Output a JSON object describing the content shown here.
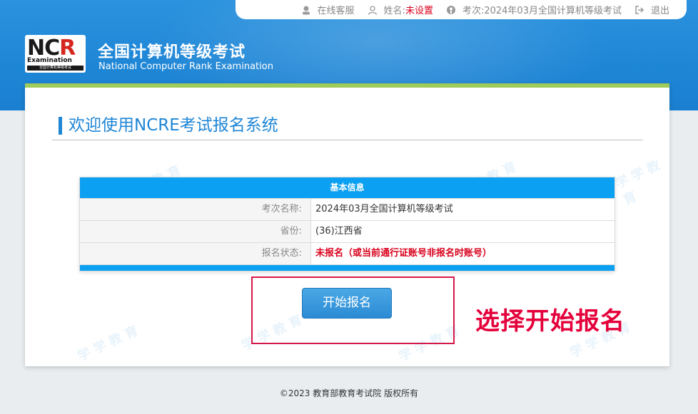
{
  "topbar": {
    "service": "在线客服",
    "name_label": "姓名:",
    "name_value": "未设置",
    "session_label": "考次:",
    "session_value": "2024年03月全国计算机等级考试",
    "logout": "退出"
  },
  "branding": {
    "logo_ncr_a": "NC",
    "logo_ncr_b": "R",
    "logo_exam": "Examination",
    "logo_strip": "全国计算机等级考试",
    "title": "全国计算机等级考试",
    "subtitle": "National Computer Rank Examination"
  },
  "main": {
    "welcome": "欢迎使用NCRE考试报名系统",
    "table_title": "基本信息",
    "rows": [
      {
        "label": "考次名称:",
        "value": "2024年03月全国计算机等级考试"
      },
      {
        "label": "省份:",
        "value": "(36)江西省"
      },
      {
        "label": "报名状态:",
        "value": "未报名（或当前通行证账号非报名时账号）"
      }
    ],
    "start_button": "开始报名",
    "annotation": "选择开始报名"
  },
  "footer": {
    "copyright": "©2023  教育部教育考试院  版权所有"
  },
  "watermark": {
    "text": "学 学 教 育"
  },
  "icons": {
    "service": "headset-icon",
    "user": "user-icon",
    "session": "exam-icon",
    "logout": "logout-icon"
  },
  "colors": {
    "brand_blue": "#1f86d6",
    "table_blue": "#0ba0f2",
    "accent_green": "#9fcb5b",
    "alert_red": "#d9001b",
    "annotation_red": "#e4003a"
  }
}
